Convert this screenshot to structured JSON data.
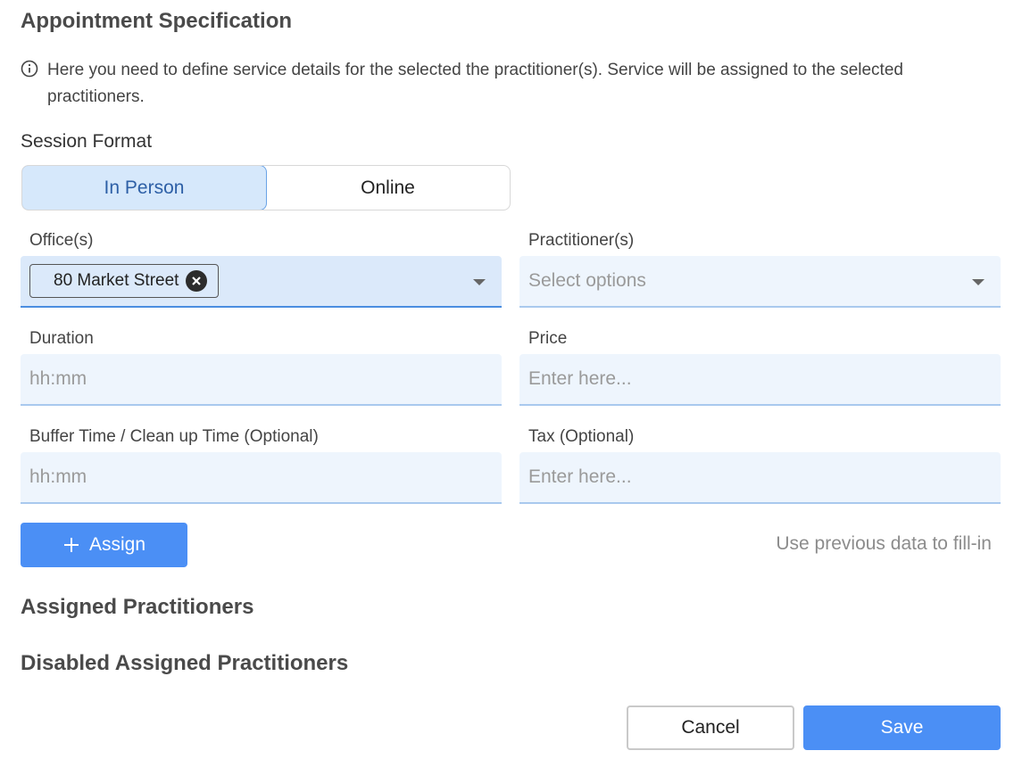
{
  "title": "Appointment Specification",
  "info": {
    "icon": "info-circle-icon",
    "text": "Here you need to define service details for the selected the practitioner(s). Service will be assigned to the selected practitioners."
  },
  "session_format": {
    "label": "Session Format",
    "options": [
      "In Person",
      "Online"
    ],
    "selected": "In Person"
  },
  "office": {
    "label": "Office(s)",
    "chips": [
      "80 Market Street"
    ]
  },
  "practitioner": {
    "label": "Practitioner(s)",
    "placeholder": "Select options"
  },
  "duration": {
    "label": "Duration",
    "placeholder": "hh:mm"
  },
  "price": {
    "label": "Price",
    "placeholder": "Enter here..."
  },
  "buffer": {
    "label": "Buffer Time / Clean up Time (Optional)",
    "placeholder": "hh:mm"
  },
  "tax": {
    "label": "Tax (Optional)",
    "placeholder": "Enter here..."
  },
  "assign_button": "Assign",
  "fill_link": "Use previous data to fill-in",
  "assigned_heading": "Assigned Practitioners",
  "disabled_heading": "Disabled Assigned Practitioners",
  "footer": {
    "cancel": "Cancel",
    "save": "Save"
  },
  "colors": {
    "primary": "#4b8ff5",
    "active_segment_bg": "#d6e8fb",
    "field_bg": "#eef5fd"
  }
}
